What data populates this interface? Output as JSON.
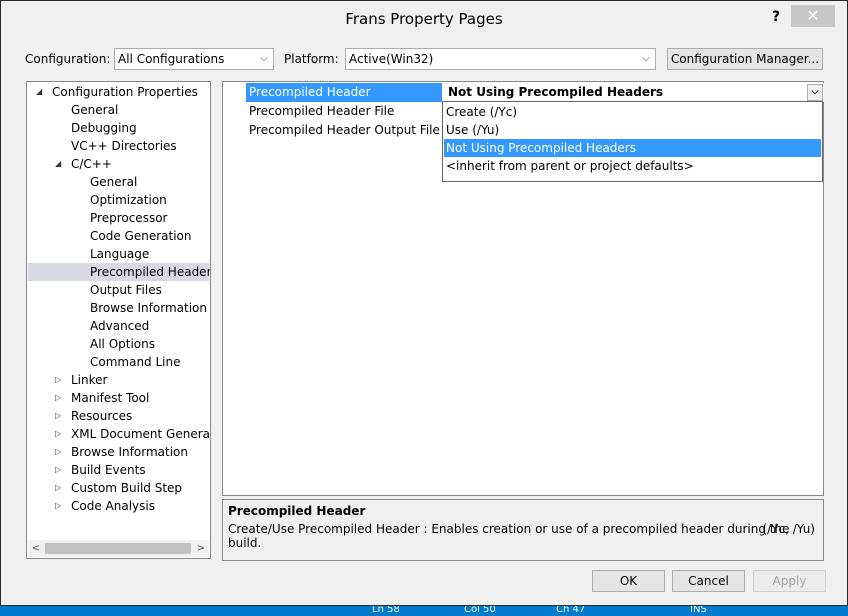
{
  "window": {
    "title": "Frans Property Pages",
    "help_label": "?",
    "close_label": "✕"
  },
  "config_bar": {
    "configuration_label": "Configuration:",
    "configuration_value": "All Configurations",
    "platform_label": "Platform:",
    "platform_value": "Active(Win32)",
    "manager_button": "Configuration Manager..."
  },
  "tree": {
    "items": [
      {
        "label": "Configuration Properties",
        "expander": "◢"
      },
      {
        "label": "General"
      },
      {
        "label": "Debugging"
      },
      {
        "label": "VC++ Directories"
      },
      {
        "label": "C/C++",
        "expander": "◢"
      },
      {
        "label": "General"
      },
      {
        "label": "Optimization"
      },
      {
        "label": "Preprocessor"
      },
      {
        "label": "Code Generation"
      },
      {
        "label": "Language"
      },
      {
        "label": "Precompiled Headers",
        "selected": true
      },
      {
        "label": "Output Files"
      },
      {
        "label": "Browse Information"
      },
      {
        "label": "Advanced"
      },
      {
        "label": "All Options"
      },
      {
        "label": "Command Line"
      },
      {
        "label": "Linker",
        "expander": "▷"
      },
      {
        "label": "Manifest Tool",
        "expander": "▷"
      },
      {
        "label": "Resources",
        "expander": "▷"
      },
      {
        "label": "XML Document Generator",
        "expander": "▷"
      },
      {
        "label": "Browse Information",
        "expander": "▷"
      },
      {
        "label": "Build Events",
        "expander": "▷"
      },
      {
        "label": "Custom Build Step",
        "expander": "▷"
      },
      {
        "label": "Code Analysis",
        "expander": "▷"
      }
    ]
  },
  "grid": {
    "rows": [
      {
        "name": "Precompiled Header",
        "value": "Not Using Precompiled Headers"
      },
      {
        "name": "Precompiled Header File",
        "value": ""
      },
      {
        "name": "Precompiled Header Output File",
        "value": ""
      }
    ]
  },
  "dropdown": {
    "options": [
      "Create (/Yc)",
      "Use (/Yu)",
      "Not Using Precompiled Headers",
      "<inherit from parent or project defaults>"
    ],
    "selected_index": 2
  },
  "description": {
    "title": "Precompiled Header",
    "text": "Create/Use Precompiled Header : Enables creation or use of a precompiled header during the build.",
    "switches": "(/Yc, /Yu)"
  },
  "buttons": {
    "ok": "OK",
    "cancel": "Cancel",
    "apply": "Apply"
  },
  "statusbar": {
    "ln": "Ln 58",
    "col": "Col 50",
    "ch": "Ch 47",
    "ins": "INS"
  },
  "colors": {
    "selection": "#3399ff",
    "status_bar": "#007acc",
    "tree_selection": "#d9d9e6"
  }
}
